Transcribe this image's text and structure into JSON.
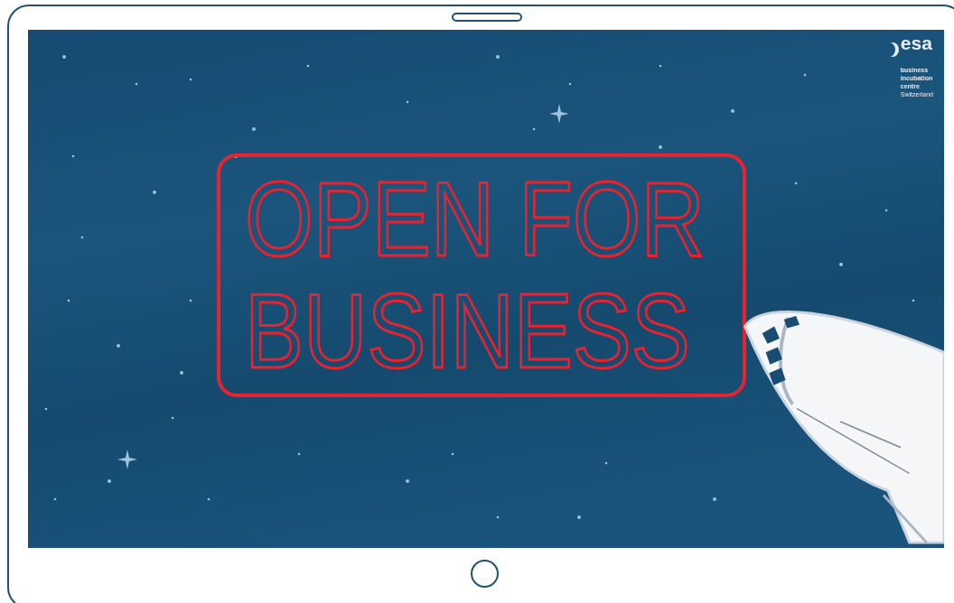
{
  "screen": {
    "logo": {
      "wordmark": "esa",
      "lines": [
        "business",
        "incubation",
        "centre",
        "Switzerland"
      ]
    },
    "sign": {
      "lines": [
        "OPEN FOR",
        "BUSINESS"
      ]
    }
  }
}
